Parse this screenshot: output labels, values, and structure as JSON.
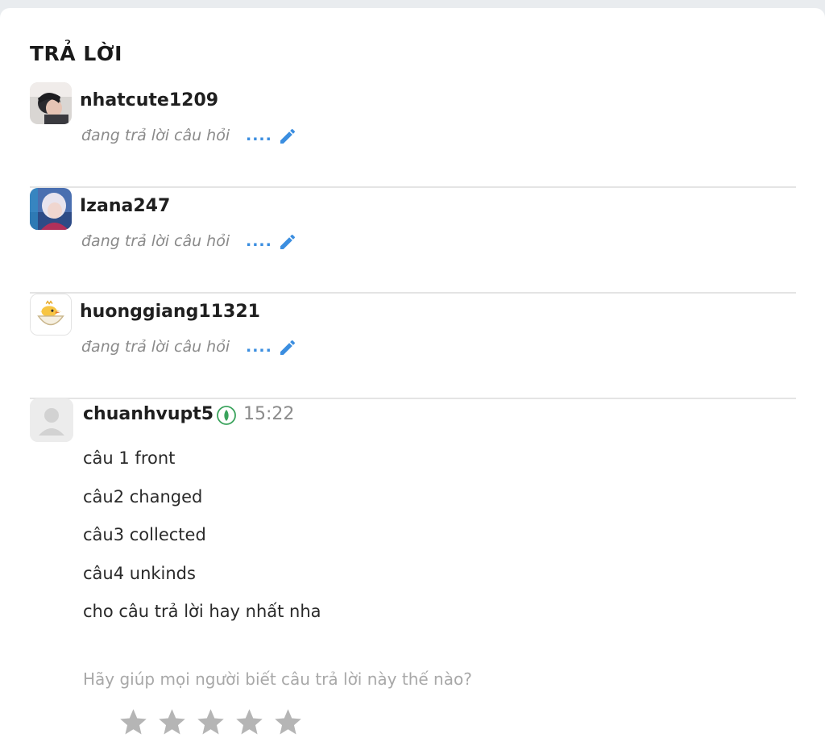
{
  "section_title": "TRẢ LỜI",
  "typing_users": [
    {
      "username": "nhatcute1209",
      "status": "đang trả lời câu hỏi",
      "dots": "....",
      "avatar_icon": "user-photo-avatar"
    },
    {
      "username": "Izana247",
      "status": "đang trả lời câu hỏi",
      "dots": "....",
      "avatar_icon": "anime-character-avatar"
    },
    {
      "username": "huonggiang11321",
      "status": "đang trả lời câu hỏi",
      "dots": "....",
      "avatar_icon": "chick-avatar"
    }
  ],
  "answer": {
    "username": "chuanhvupt5",
    "time": "15:22",
    "verified_icon": "verified-badge-icon",
    "lines": [
      "câu 1 front",
      "câu2 changed",
      "câu3 collected",
      "câu4 unkinds",
      "cho câu trả lời hay nhất nha"
    ]
  },
  "rating": {
    "prompt": "Hãy giúp mọi người biết câu trả lời này thế nào?",
    "star_count": 5,
    "star_icon": "star-icon"
  },
  "colors": {
    "accent_blue": "#3b8ee0",
    "verified_green": "#3aa35c",
    "star_gray": "#b5b5b5",
    "divider": "#e4e4e4"
  }
}
